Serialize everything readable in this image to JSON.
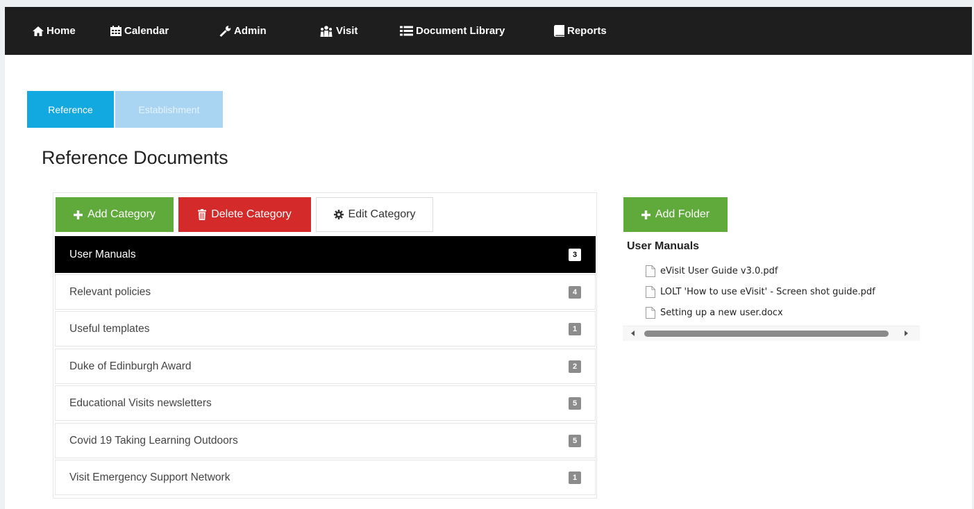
{
  "nav": {
    "items": [
      {
        "label": "Home",
        "icon": "home-icon"
      },
      {
        "label": "Calendar",
        "icon": "calendar-icon"
      },
      {
        "label": "Admin",
        "icon": "wrench-icon"
      },
      {
        "label": "Visit",
        "icon": "group-icon"
      },
      {
        "label": "Document Library",
        "icon": "list-icon"
      },
      {
        "label": "Reports",
        "icon": "book-icon"
      }
    ]
  },
  "tabs": [
    {
      "label": "Reference",
      "active": true
    },
    {
      "label": "Establishment",
      "active": false
    }
  ],
  "page": {
    "title": "Reference Documents"
  },
  "toolbar": {
    "add_category": "Add Category",
    "delete_category": "Delete Category",
    "edit_category": "Edit Category",
    "add_folder": "Add Folder"
  },
  "categories": [
    {
      "label": "User Manuals",
      "count": "3",
      "active": true
    },
    {
      "label": "Relevant policies",
      "count": "4",
      "active": false
    },
    {
      "label": "Useful templates",
      "count": "1",
      "active": false
    },
    {
      "label": "Duke of Edinburgh Award",
      "count": "2",
      "active": false
    },
    {
      "label": "Educational Visits newsletters",
      "count": "5",
      "active": false
    },
    {
      "label": "Covid 19 Taking Learning Outdoors",
      "count": "5",
      "active": false
    },
    {
      "label": "Visit Emergency Support Network",
      "count": "1",
      "active": false
    }
  ],
  "folder": {
    "title": "User Manuals",
    "files": [
      "eVisit User Guide v3.0.pdf",
      "LOLT 'How to use eVisit' - Screen shot guide.pdf",
      "Setting up a new user.docx"
    ]
  },
  "colors": {
    "navbar": "#1e1e1e",
    "tab_active": "#12a8e0",
    "tab_inactive": "#a9d4f2",
    "success": "#5faa3a",
    "danger": "#d42a2a",
    "active_row": "#000000",
    "badge": "#8c8c8c"
  }
}
